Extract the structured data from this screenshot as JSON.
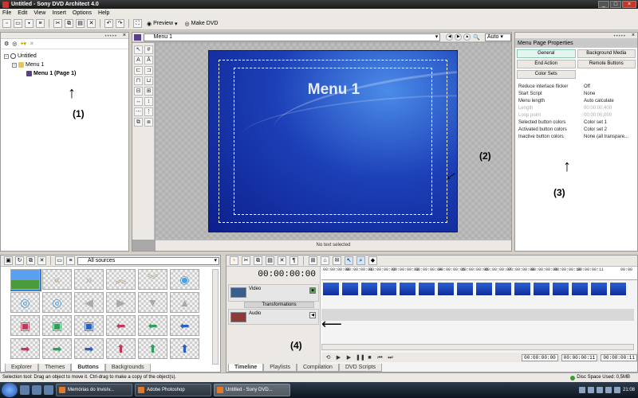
{
  "window": {
    "title": "Untitled - Sony DVD Architect 4.0"
  },
  "menubar": [
    "File",
    "Edit",
    "View",
    "Insert",
    "Options",
    "Help"
  ],
  "toolbar": {
    "preview_label": "Preview",
    "make_dvd_label": "Make DVD"
  },
  "explorer": {
    "tree": [
      {
        "label": "Untitled",
        "level": 0
      },
      {
        "label": "Menu 1",
        "level": 1
      },
      {
        "label": "Menu 1 (Page 1)",
        "level": 2
      }
    ]
  },
  "workspace": {
    "selector_value": "Menu 1",
    "zoom": "Auto",
    "menu_title": "Menu 1",
    "status": "No text selected"
  },
  "properties": {
    "title": "Menu Page Properties",
    "tabs": [
      "General",
      "Background Media",
      "End Action",
      "Remote Buttons",
      "Color Sets"
    ],
    "rows": [
      {
        "k": "Reduce interlace flicker",
        "v": "Off",
        "dim": false
      },
      {
        "k": "Start Script",
        "v": "None",
        "dim": false
      },
      {
        "k": "Menu length",
        "v": "Auto calculate",
        "dim": false
      },
      {
        "k": "Length",
        "v": "00:00:00,400",
        "dim": true
      },
      {
        "k": "Loop point",
        "v": "00:00:00,000",
        "dim": true
      },
      {
        "k": "Selected button colors",
        "v": "Color set 1",
        "dim": false
      },
      {
        "k": "Activated button colors",
        "v": "Color set 2",
        "dim": false
      },
      {
        "k": "Inactive button colors",
        "v": "None (all transpare...",
        "dim": false
      }
    ]
  },
  "annotations": {
    "a1": "(1)",
    "a2": "(2)",
    "a3": "(3)",
    "a4": "(4)"
  },
  "media": {
    "source": "All sources",
    "tabs": [
      "Explorer",
      "Themes",
      "Buttons",
      "Backgrounds"
    ],
    "active_tab": "Buttons"
  },
  "timeline": {
    "time": "00:00:00:00",
    "tracks": {
      "video": "Video",
      "transformations": "Transformations",
      "audio": "Audio"
    },
    "ruler": [
      "00:00:00:00",
      "00:00:00:01",
      "00:00:00:02",
      "00:00:00:03",
      "00:00:00:04",
      "00:00:00:05",
      "00:00:00:06",
      "00:00:00:07",
      "00:00:00:08",
      "00:00:00:09",
      "00:00:00:10",
      "00:00:00:11",
      "00:00"
    ],
    "timecodes": [
      "00:00:00:00",
      "00:00:00:11",
      "00:00:00:11"
    ],
    "tabs": [
      "Timeline",
      "Playlists",
      "Compilation",
      "DVD Scripts"
    ],
    "active_tab": "Timeline"
  },
  "statusbar": {
    "message": "Selection tool: Drag an object to move it.  Ctrl-drag to make a copy of the object(s).",
    "disc": "Disc Space Used: 0,5MB"
  },
  "taskbar": {
    "tasks": [
      "Memórias do Invisív...",
      "Adobe Photoshop",
      "Untitled - Sony DVD..."
    ],
    "clock": "21:08"
  }
}
